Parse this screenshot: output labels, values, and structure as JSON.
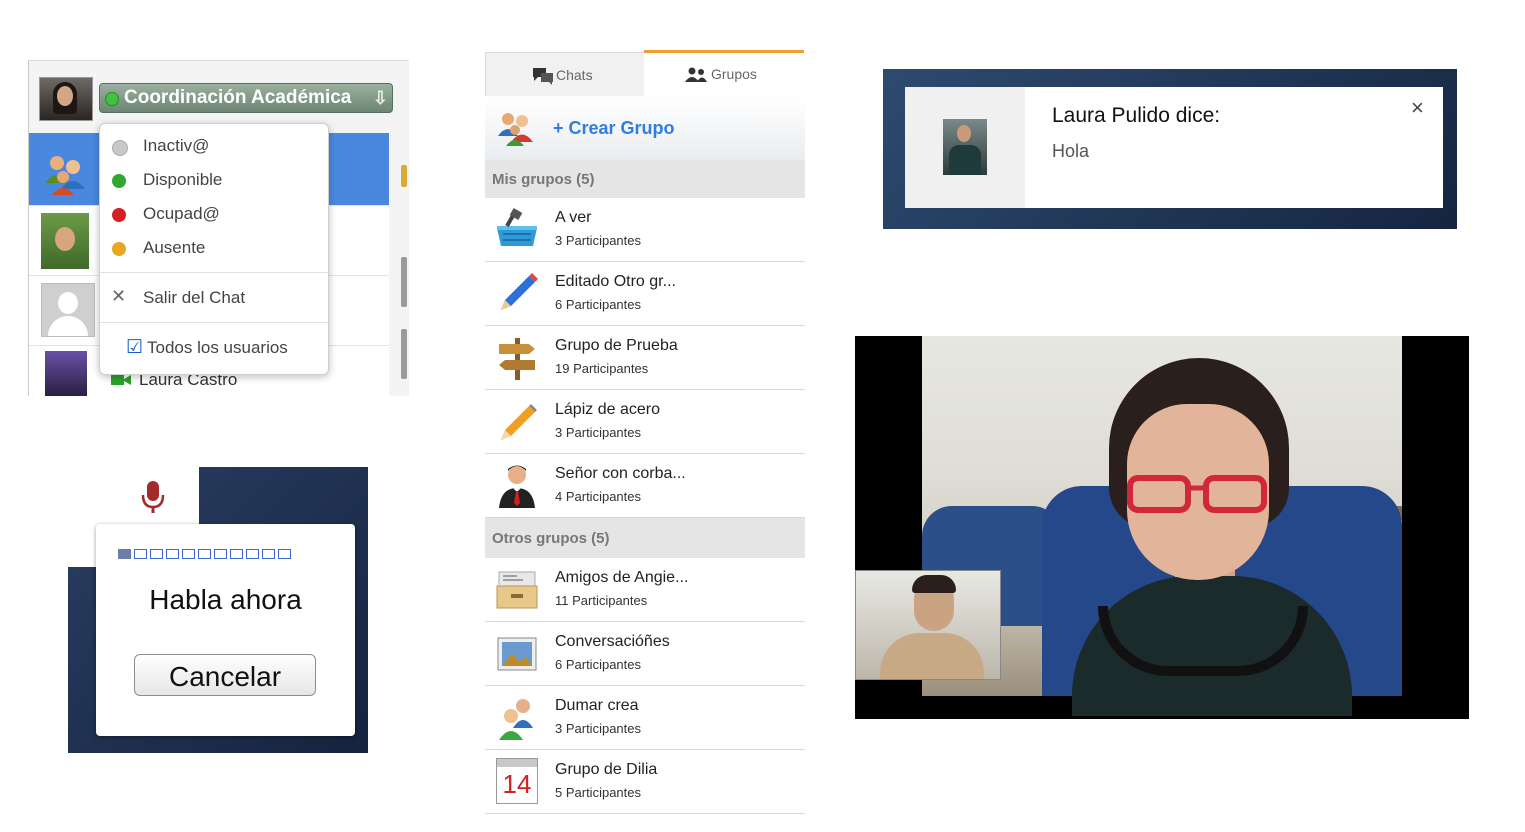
{
  "status_panel": {
    "current_status": "Coordinación Académica",
    "menu": [
      {
        "label": "Inactiv@",
        "color": "#b8b8b8"
      },
      {
        "label": "Disponible",
        "color": "#2ea82e"
      },
      {
        "label": "Ocupad@",
        "color": "#d42020"
      },
      {
        "label": "Ausente",
        "color": "#e6a820"
      }
    ],
    "leave_label": "Salir del Chat",
    "all_users_label": "Todos los usuarios",
    "all_users_checked": true,
    "contact_name": "Laura Castro"
  },
  "voice_prompt": {
    "meter_total": 11,
    "meter_active": 1,
    "prompt": "Habla ahora",
    "cancel_label": "Cancelar"
  },
  "groups_panel": {
    "tabs": [
      {
        "label": "Chats",
        "active": false
      },
      {
        "label": "Grupos",
        "active": true
      }
    ],
    "create_label": "+ Crear Grupo",
    "my_groups_header": "Mis grupos (5)",
    "my_groups": [
      {
        "name": "A ver",
        "count": "3 Participantes",
        "icon": "basket-icon"
      },
      {
        "name": "Editado Otro gr...",
        "count": "6 Participantes",
        "icon": "pencil-icon"
      },
      {
        "name": "Grupo de Prueba",
        "count": "19 Participantes",
        "icon": "signpost-icon"
      },
      {
        "name": "Lápiz de acero",
        "count": "3 Participantes",
        "icon": "pencil-orange-icon"
      },
      {
        "name": "Señor con corba...",
        "count": "4 Participantes",
        "icon": "businessman-icon"
      }
    ],
    "other_groups_header": "Otros grupos (5)",
    "other_groups": [
      {
        "name": "Amigos de Angie...",
        "count": "11 Participantes",
        "icon": "drawer-icon"
      },
      {
        "name": "Conversacióñes",
        "count": "6 Participantes",
        "icon": "picture-icon"
      },
      {
        "name": "Dumar crea",
        "count": "3 Participantes",
        "icon": "users-icon"
      },
      {
        "name": "Grupo de Dilia",
        "count": "5 Participantes",
        "icon": "calendar-icon",
        "calendar_day": "14"
      }
    ]
  },
  "notification": {
    "title": "Laura Pulido dice:",
    "message": "Hola",
    "close": "×"
  },
  "colors": {
    "selected_row": "#4a88df",
    "link_blue": "#2f7ee0",
    "tab_accent": "#f0a030",
    "status_green": "#3fc43f"
  }
}
